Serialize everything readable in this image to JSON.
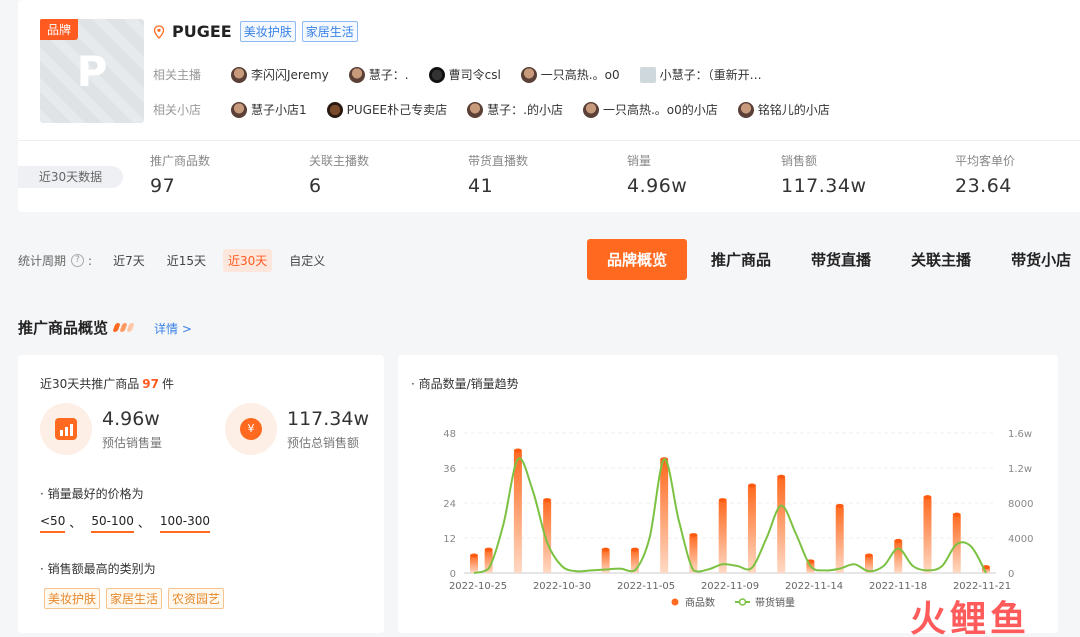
{
  "brand": {
    "badge": "品牌",
    "logo_letter": "P",
    "name": "PUGEE",
    "tags": [
      "美妆护肤",
      "家居生活"
    ],
    "related_anchors_label": "相关主播",
    "related_anchors": [
      "李闪闪Jeremy",
      "慧子：.",
      "曹司令csl",
      "一只高热.。o0",
      "小慧子：（重新开…"
    ],
    "related_shops_label": "相关小店",
    "related_shops": [
      "慧子小店1",
      "PUGEE朴己专卖店",
      "慧子：.的小店",
      "一只高热.。o0的小店",
      "铭铭儿的小店"
    ]
  },
  "stats": {
    "period_label": "近30天数据",
    "items": [
      {
        "label": "推广商品数",
        "value": "97"
      },
      {
        "label": "关联主播数",
        "value": "6"
      },
      {
        "label": "带货直播数",
        "value": "41"
      },
      {
        "label": "销量",
        "value": "4.96w"
      },
      {
        "label": "销售额",
        "value": "117.34w"
      },
      {
        "label": "平均客单价",
        "value": "23.64"
      }
    ]
  },
  "period": {
    "label": "统计周期",
    "options": [
      "近7天",
      "近15天",
      "近30天",
      "自定义"
    ],
    "active": "近30天"
  },
  "tabs": [
    "品牌概览",
    "推广商品",
    "带货直播",
    "关联主播",
    "带货小店"
  ],
  "section": {
    "title": "推广商品概览",
    "detail": "详情 >"
  },
  "summary": {
    "head_prefix": "近30天共推广商品",
    "head_count": "97",
    "head_suffix": "件",
    "sales_value": "4.96w",
    "sales_label": "预估销售量",
    "revenue_value": "117.34w",
    "revenue_label": "预估总销售额",
    "best_price_title": "· 销量最好的价格为",
    "price_ranges": [
      "<50",
      "50-100",
      "100-300"
    ],
    "top_category_title": "· 销售额最高的类别为",
    "categories": [
      "美妆护肤",
      "家居生活",
      "农资园艺"
    ]
  },
  "chart_title": "· 商品数量/销量趋势",
  "chart_data": {
    "type": "bar",
    "title": "商品数量/销量趋势",
    "x_tick_labels": [
      "2022-10-25",
      "2022-10-30",
      "2022-11-05",
      "2022-11-09",
      "2022-11-14",
      "2022-11-18",
      "2022-11-21"
    ],
    "y_left_ticks": [
      "0",
      "12",
      "24",
      "36",
      "48"
    ],
    "y_right_ticks": [
      "0",
      "4000",
      "8000",
      "1.2w",
      "1.6w"
    ],
    "y_left_range": [
      0,
      48
    ],
    "y_right_range": [
      0,
      16000
    ],
    "series": [
      {
        "name": "商品数",
        "type": "bar",
        "axis": "left",
        "color": "#ff6a20",
        "values": [
          6,
          8,
          0,
          42,
          0,
          25,
          0,
          0,
          0,
          8,
          0,
          8,
          0,
          39,
          0,
          13,
          0,
          25,
          0,
          30,
          0,
          33,
          0,
          4,
          0,
          23,
          0,
          6,
          0,
          11,
          0,
          26,
          0,
          20,
          0,
          2
        ]
      },
      {
        "name": "带货销量",
        "type": "line",
        "axis": "right",
        "color": "#7cc242",
        "values": [
          0,
          500,
          5500,
          13000,
          9500,
          3500,
          800,
          200,
          300,
          400,
          500,
          300,
          4000,
          13000,
          6000,
          300,
          400,
          1000,
          800,
          600,
          4000,
          7700,
          4500,
          800,
          300,
          500,
          1000,
          200,
          800,
          2800,
          800,
          300,
          800,
          3300,
          3000,
          0
        ]
      }
    ],
    "legend_position": "bottom"
  },
  "watermark": "火鲤鱼"
}
